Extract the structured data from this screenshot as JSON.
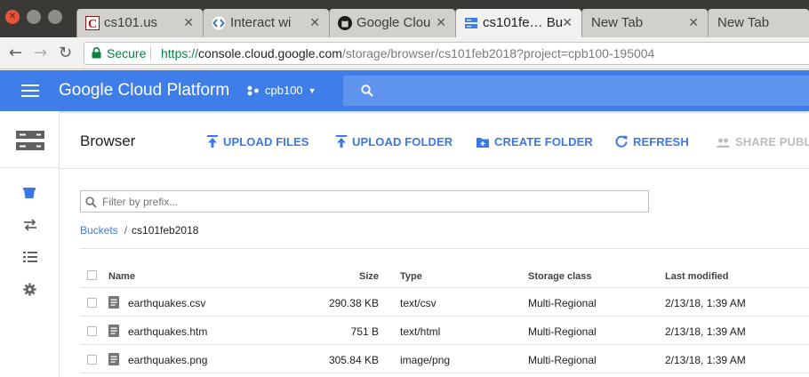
{
  "browser": {
    "tabs": [
      {
        "title": "cs101.us",
        "icon": "c-favicon",
        "active": false
      },
      {
        "title": "Interact wi",
        "icon": "code-favicon",
        "active": false
      },
      {
        "title": "Google Clou",
        "icon": "github-favicon",
        "active": false
      },
      {
        "title": "cs101fe… Bu",
        "icon": "storage-favicon",
        "active": true
      },
      {
        "title": "New Tab",
        "icon": "",
        "active": false
      },
      {
        "title": "New Tab",
        "icon": "",
        "active": false
      }
    ],
    "secure_label": "Secure",
    "url_scheme": "https://",
    "url_host": "console.cloud.google.com",
    "url_path": "/storage/browser/cs101feb2018?project=cpb100-195004"
  },
  "header": {
    "title": "Google Cloud Platform",
    "project": "cpb100"
  },
  "toolbar": {
    "title": "Browser",
    "upload_files": "UPLOAD FILES",
    "upload_folder": "UPLOAD FOLDER",
    "create_folder": "CREATE FOLDER",
    "refresh": "REFRESH",
    "share_public": "SHARE PUBLIC"
  },
  "filter": {
    "placeholder": "Filter by prefix..."
  },
  "breadcrumb": {
    "root": "Buckets",
    "separator": "/",
    "current": "cs101feb2018"
  },
  "table": {
    "columns": {
      "name": "Name",
      "size": "Size",
      "type": "Type",
      "storage_class": "Storage class",
      "last_modified": "Last modified"
    },
    "rows": [
      {
        "name": "earthquakes.csv",
        "size": "290.38 KB",
        "type": "text/csv",
        "storage_class": "Multi-Regional",
        "last_modified": "2/13/18, 1:39 AM"
      },
      {
        "name": "earthquakes.htm",
        "size": "751 B",
        "type": "text/html",
        "storage_class": "Multi-Regional",
        "last_modified": "2/13/18, 1:39 AM"
      },
      {
        "name": "earthquakes.png",
        "size": "305.84 KB",
        "type": "image/png",
        "storage_class": "Multi-Regional",
        "last_modified": "2/13/18, 1:39 AM"
      }
    ]
  },
  "colors": {
    "gcp_blue": "#3f7de8",
    "link_blue": "#3b78e7",
    "secure_green": "#0b8043"
  }
}
